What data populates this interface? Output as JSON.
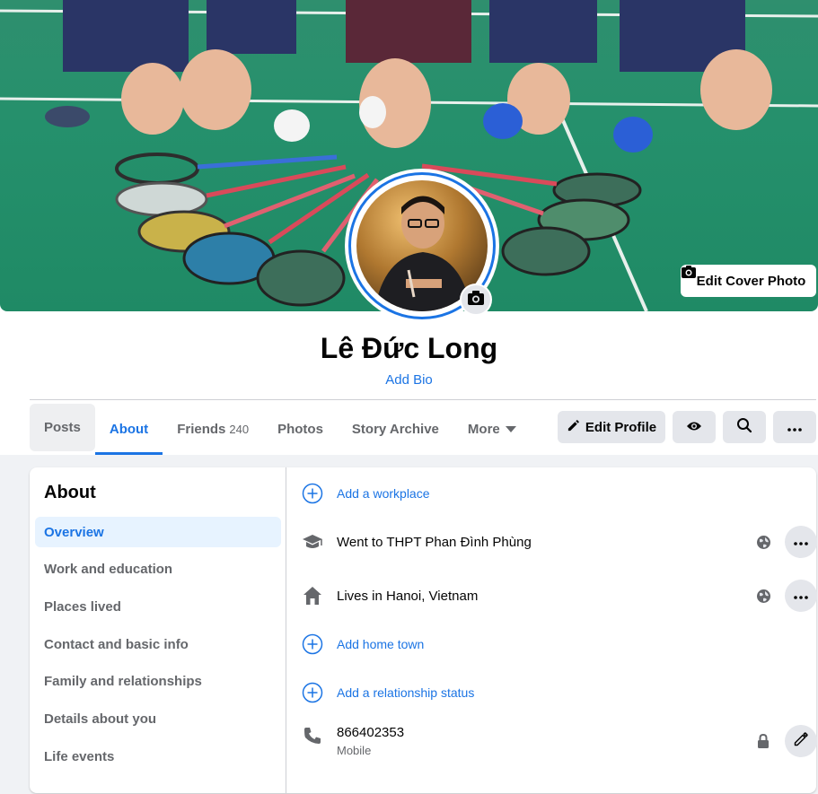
{
  "cover": {
    "edit_cover_label": "Edit Cover Photo"
  },
  "profile": {
    "name": "Lê Đức Long",
    "add_bio": "Add Bio"
  },
  "tabs": [
    {
      "label": "Posts",
      "count": ""
    },
    {
      "label": "About",
      "count": ""
    },
    {
      "label": "Friends",
      "count": "240"
    },
    {
      "label": "Photos",
      "count": ""
    },
    {
      "label": "Story Archive",
      "count": ""
    },
    {
      "label": "More",
      "count": ""
    }
  ],
  "actions": {
    "edit_profile": "Edit Profile"
  },
  "about": {
    "title": "About",
    "sidebar": [
      {
        "label": "Overview"
      },
      {
        "label": "Work and education"
      },
      {
        "label": "Places lived"
      },
      {
        "label": "Contact and basic info"
      },
      {
        "label": "Family and relationships"
      },
      {
        "label": "Details about you"
      },
      {
        "label": "Life events"
      }
    ],
    "rows": {
      "add_workplace": "Add a workplace",
      "education": "Went to THPT Phan Đình Phùng",
      "lives_in": "Lives in Hanoi, Vietnam",
      "add_hometown": "Add home town",
      "add_relationship": "Add a relationship status",
      "phone": "866402353",
      "phone_type": "Mobile"
    }
  },
  "colors": {
    "accent": "#1b74e4",
    "secondary_text": "#65676b",
    "button_bg": "#e4e6eb",
    "active_bg": "#e7f3ff"
  }
}
